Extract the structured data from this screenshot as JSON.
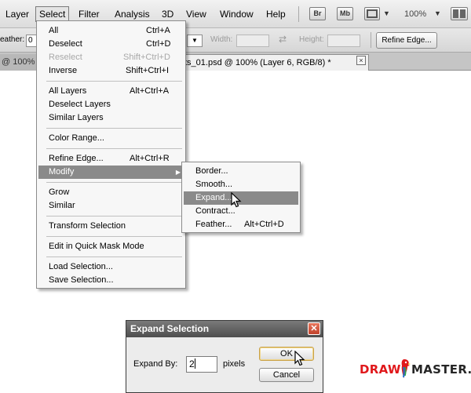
{
  "menubar": {
    "items": [
      "Layer",
      "Select",
      "Filter",
      "Analysis",
      "3D",
      "View",
      "Window",
      "Help"
    ],
    "icons": {
      "bridge": "Br",
      "mini_bridge": "Mb"
    },
    "zoom": "100%"
  },
  "options": {
    "feather_label": "eather:",
    "feather_value": "0",
    "width_label": "Width:",
    "height_label": "Height:",
    "refine_edge": "Refine Edge..."
  },
  "tabs": {
    "left": "@ 100%",
    "active": "ts_01.psd @ 100% (Layer 6, RGB/8) *",
    "close": "×"
  },
  "select_menu": {
    "items": [
      {
        "label": "All",
        "shortcut": "Ctrl+A"
      },
      {
        "label": "Deselect",
        "shortcut": "Ctrl+D"
      },
      {
        "label": "Reselect",
        "shortcut": "Shift+Ctrl+D"
      },
      {
        "label": "Inverse",
        "shortcut": "Shift+Ctrl+I"
      },
      {
        "label": "All Layers",
        "shortcut": "Alt+Ctrl+A"
      },
      {
        "label": "Deselect Layers",
        "shortcut": ""
      },
      {
        "label": "Similar Layers",
        "shortcut": ""
      },
      {
        "label": "Color Range...",
        "shortcut": ""
      },
      {
        "label": "Refine Edge...",
        "shortcut": "Alt+Ctrl+R"
      },
      {
        "label": "Modify",
        "shortcut": ""
      },
      {
        "label": "Grow",
        "shortcut": ""
      },
      {
        "label": "Similar",
        "shortcut": ""
      },
      {
        "label": "Transform Selection",
        "shortcut": ""
      },
      {
        "label": "Edit in Quick Mask Mode",
        "shortcut": ""
      },
      {
        "label": "Load Selection...",
        "shortcut": ""
      },
      {
        "label": "Save Selection...",
        "shortcut": ""
      }
    ]
  },
  "modify_menu": {
    "items": [
      {
        "label": "Border...",
        "shortcut": ""
      },
      {
        "label": "Smooth...",
        "shortcut": ""
      },
      {
        "label": "Expand...",
        "shortcut": ""
      },
      {
        "label": "Contract...",
        "shortcut": ""
      },
      {
        "label": "Feather...",
        "shortcut": "Alt+Ctrl+D"
      }
    ]
  },
  "dialog": {
    "title": "Expand Selection",
    "expand_by_label": "Expand By:",
    "expand_by_value": "2",
    "unit": "pixels",
    "ok": "OK",
    "cancel": "Cancel"
  },
  "watermark": {
    "part1": "DRAW",
    "part2": "MASTER.RU"
  },
  "colors": {
    "menu_highlight": "#8a8a8a",
    "watermark_red": "#e0181b",
    "watermark_dark": "#262626"
  }
}
